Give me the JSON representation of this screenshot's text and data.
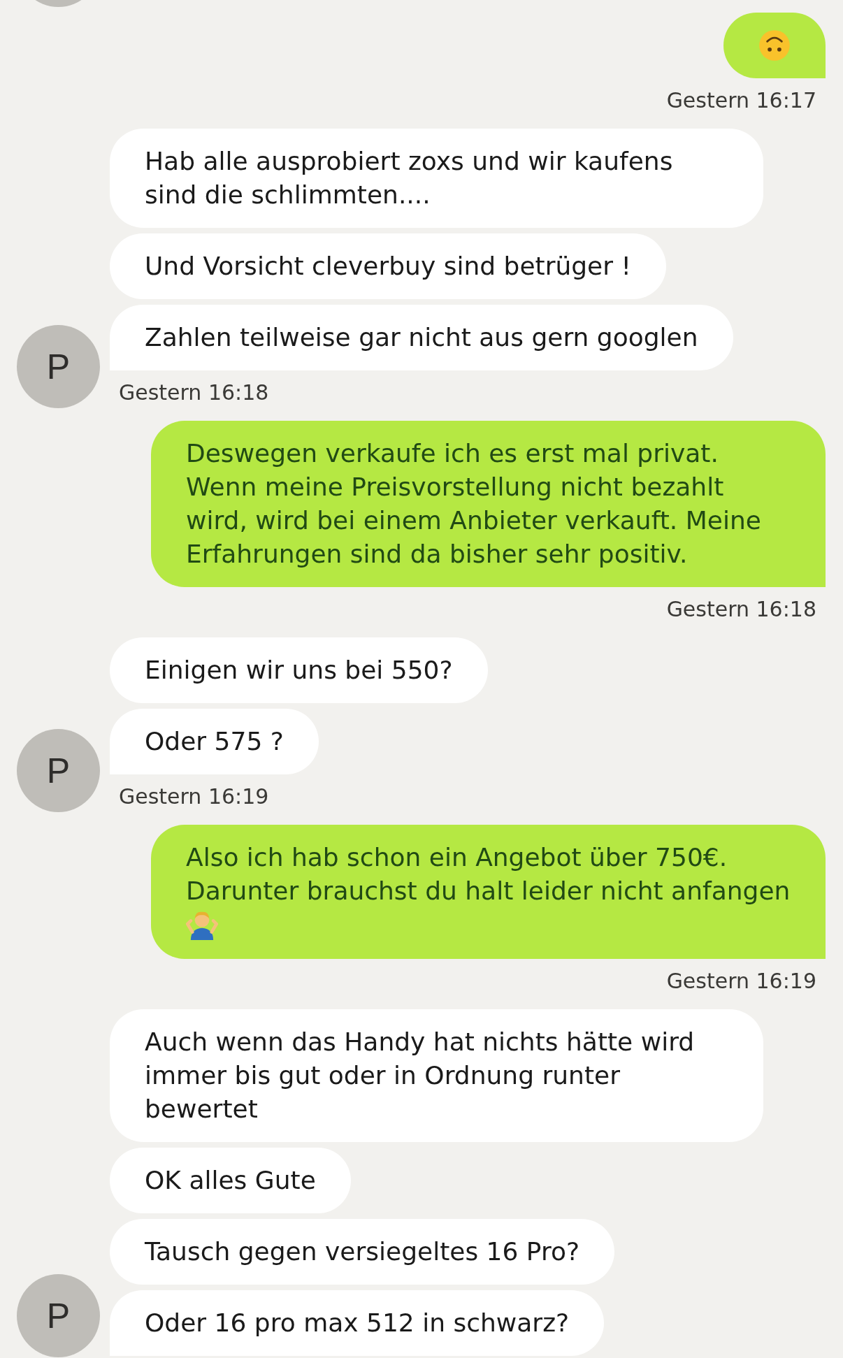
{
  "conversation": [
    {
      "kind": "avatar_edge"
    },
    {
      "kind": "outgoing",
      "messages": [
        {
          "kind": "emoji"
        }
      ],
      "time": "Gestern 16:17"
    },
    {
      "kind": "incoming",
      "avatar": "P",
      "messages": [
        {
          "kind": "text",
          "text": "Hab alle ausprobiert zoxs und wir kaufens sind die schlimmten...."
        },
        {
          "kind": "text",
          "text": "Und Vorsicht cleverbuy sind betrüger !"
        },
        {
          "kind": "text",
          "text": "Zahlen teilweise gar nicht aus gern googlen"
        }
      ],
      "time": "Gestern 16:18"
    },
    {
      "kind": "outgoing",
      "messages": [
        {
          "kind": "text",
          "text": "Deswegen verkaufe ich es erst mal privat. Wenn meine Preisvorstellung nicht bezahlt wird, wird bei einem Anbieter verkauft. Meine Erfahrungen sind da bisher sehr positiv."
        }
      ],
      "time": "Gestern 16:18"
    },
    {
      "kind": "incoming",
      "avatar": "P",
      "messages": [
        {
          "kind": "text",
          "text": "Einigen wir uns bei 550?"
        },
        {
          "kind": "text",
          "text": "Oder 575 ?"
        }
      ],
      "time": "Gestern 16:19"
    },
    {
      "kind": "outgoing",
      "messages": [
        {
          "kind": "text_emoji",
          "text": "Also ich hab schon ein Angebot über 750€. Darunter brauchst du halt leider nicht anfangen"
        }
      ],
      "time": "Gestern 16:19"
    },
    {
      "kind": "incoming",
      "avatar": "P",
      "messages": [
        {
          "kind": "text",
          "text": "Auch wenn das Handy hat nichts hätte wird immer bis gut oder in Ordnung runter bewertet"
        },
        {
          "kind": "text",
          "text": "OK alles Gute"
        },
        {
          "kind": "text",
          "text": "Tausch gegen versiegeltes 16 Pro?"
        },
        {
          "kind": "text",
          "text": "Oder 16 pro max 512 in schwarz?"
        }
      ]
    }
  ]
}
